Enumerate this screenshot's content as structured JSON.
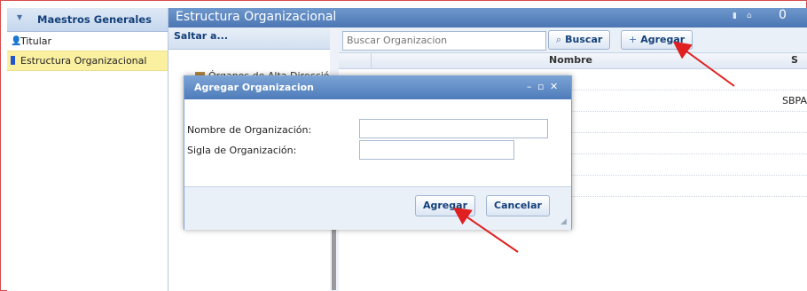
{
  "left_panel": {
    "title": "Maestros Generales",
    "items": [
      {
        "label": "Titular",
        "icon": "user-icon",
        "selected": false
      },
      {
        "label": "Estructura Organizacional",
        "icon": "book-icon",
        "selected": true
      }
    ]
  },
  "main": {
    "title": "Estructura Organizacional",
    "header_badge": "0"
  },
  "saltar": {
    "title": "Saltar a...",
    "tree_node": "Órganos de Alta Dirección"
  },
  "grid": {
    "search_placeholder": "Buscar Organizacion",
    "buscar_label": "Buscar",
    "agregar_label": "Agregar",
    "col_nombre": "Nombre",
    "col_sigla": "S",
    "row_sigla": "SBPA"
  },
  "dialog": {
    "title": "Agregar Organizacion",
    "nombre_label": "Nombre de Organización:",
    "sigla_label": "Sigla de Organización:",
    "nombre_value": "",
    "sigla_value": "",
    "agregar_label": "Agregar",
    "cancelar_label": "Cancelar"
  },
  "colors": {
    "header_blue": "#4b76b3",
    "selection": "#fbf0a0",
    "arrow_red": "#e02020"
  }
}
